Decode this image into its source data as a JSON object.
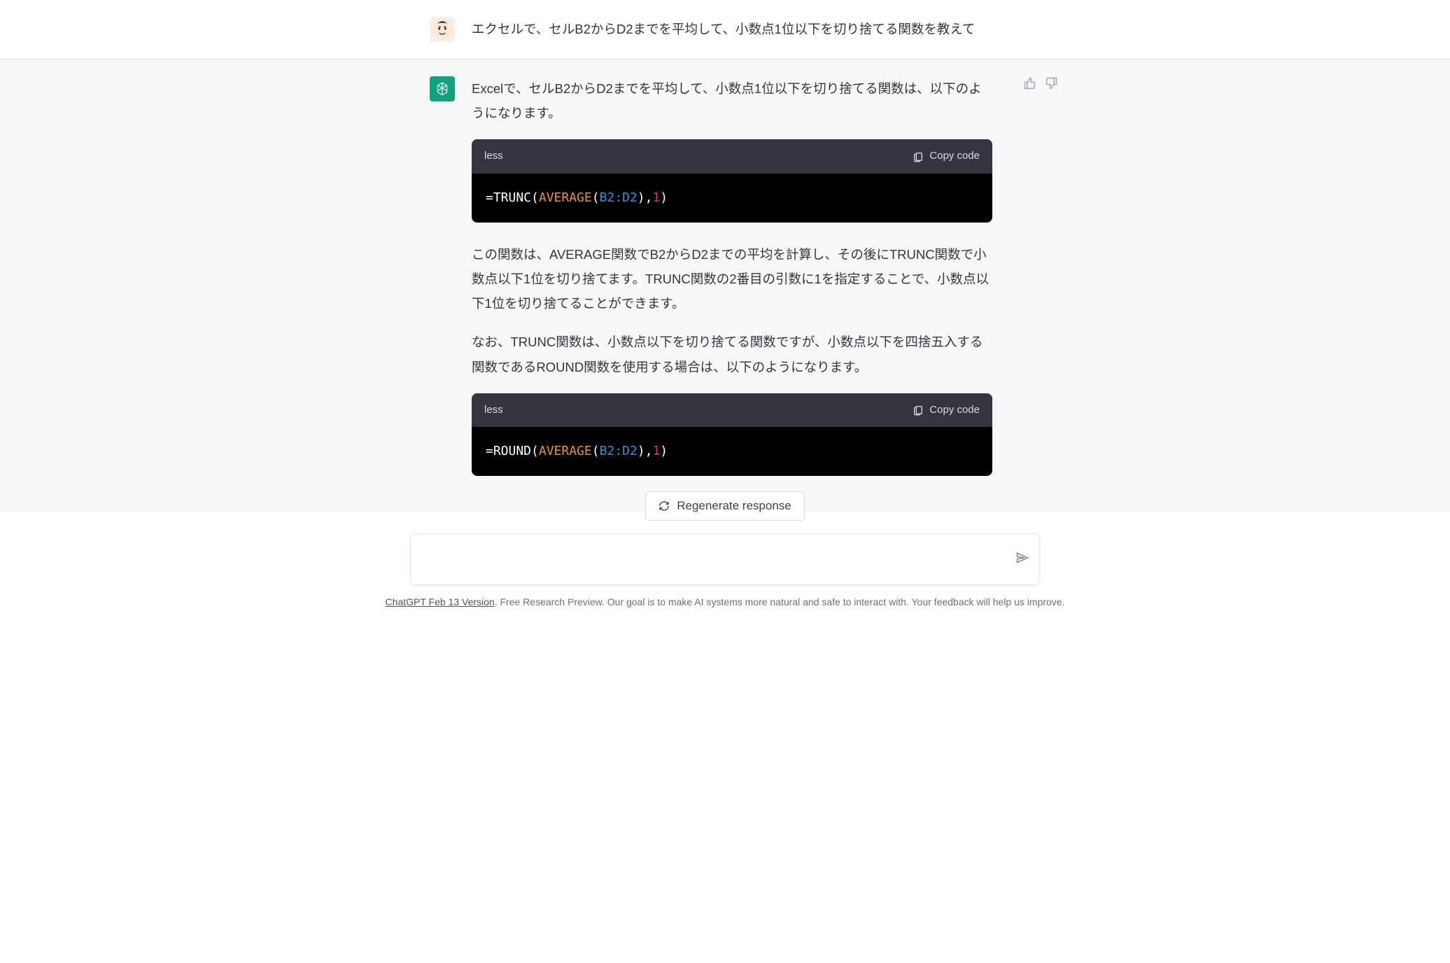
{
  "user_message": "エクセルで、セルB2からD2までを平均して、小数点1位以下を切り捨てる関数を教えて",
  "assistant": {
    "p1": "Excelで、セルB2からD2までを平均して、小数点1位以下を切り捨てる関数は、以下のようになります。",
    "code1": {
      "lang": "less",
      "copy": "Copy code",
      "tokens": {
        "pre1": "=TRUNC(",
        "fn": "AVERAGE",
        "o1": "(",
        "rng": "B2:D2",
        "o2": "),",
        "num": "1",
        "o3": ")"
      }
    },
    "p2": "この関数は、AVERAGE関数でB2からD2までの平均を計算し、その後にTRUNC関数で小数点以下1位を切り捨てます。TRUNC関数の2番目の引数に1を指定することで、小数点以下1位を切り捨てることができます。",
    "p3": "なお、TRUNC関数は、小数点以下を切り捨てる関数ですが、小数点以下を四捨五入する関数であるROUND関数を使用する場合は、以下のようになります。",
    "code2": {
      "lang": "less",
      "copy": "Copy code",
      "tokens": {
        "pre1": "=ROUND(",
        "fn": "AVERAGE",
        "o1": "(",
        "rng": "B2:D2",
        "o2": "),",
        "num": "1",
        "o3": ")"
      }
    }
  },
  "regenerate_label": "Regenerate response",
  "input_placeholder": "",
  "footer": {
    "version": "ChatGPT Feb 13 Version",
    "rest": ". Free Research Preview. Our goal is to make AI systems more natural and safe to interact with. Your feedback will help us improve."
  }
}
